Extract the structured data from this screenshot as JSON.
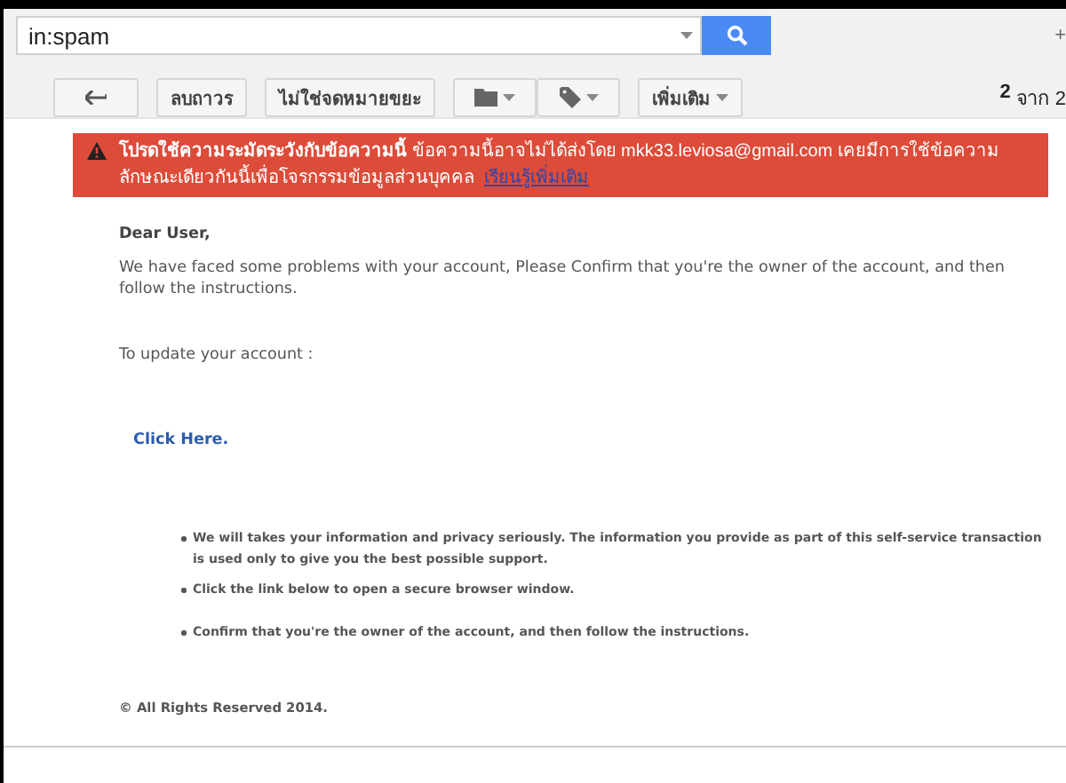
{
  "search": {
    "value": "in:spam"
  },
  "top_right": "+",
  "toolbar": {
    "buttons": [
      {
        "kind": "back"
      },
      {
        "kind": "text",
        "label": "ลบถาวร"
      },
      {
        "kind": "text",
        "label": "ไม่ใช่จดหมายขยะ"
      },
      {
        "kind": "folder"
      },
      {
        "kind": "label"
      },
      {
        "kind": "menu",
        "label": "เพิ่มเติม"
      }
    ],
    "page_count": "2",
    "page_of": "จาก 2"
  },
  "warning": {
    "title": "โปรดใช้ความระมัดระวังกับข้อความนี้",
    "text": "ข้อความนี้อาจไม่ได้ส่งโดย mkk33.leviosa@gmail.com เคยมีการใช้ข้อความลักษณะเดียวกันนี้เพื่อโจรกรรมข้อมูลส่วนบุคคล",
    "link": "เรียนรู้เพิ่มเติม"
  },
  "message": {
    "greeting": "Dear User,",
    "body": "We have faced some problems with your account, Please Confirm that you're the owner of the account, and then follow the instructions.",
    "prompt": "To update your account :",
    "link": "Click Here.",
    "bullets": [
      {
        "text": "We will takes your information and privacy seriously. The information you provide as part of this self-service transaction is used only to give you the best possible support."
      },
      {
        "text": "Click the link below to open a secure browser window."
      },
      {
        "text": "Confirm that you're the owner of the account, and then follow the instructions."
      }
    ],
    "footer": "© All Rights Reserved 2014."
  }
}
